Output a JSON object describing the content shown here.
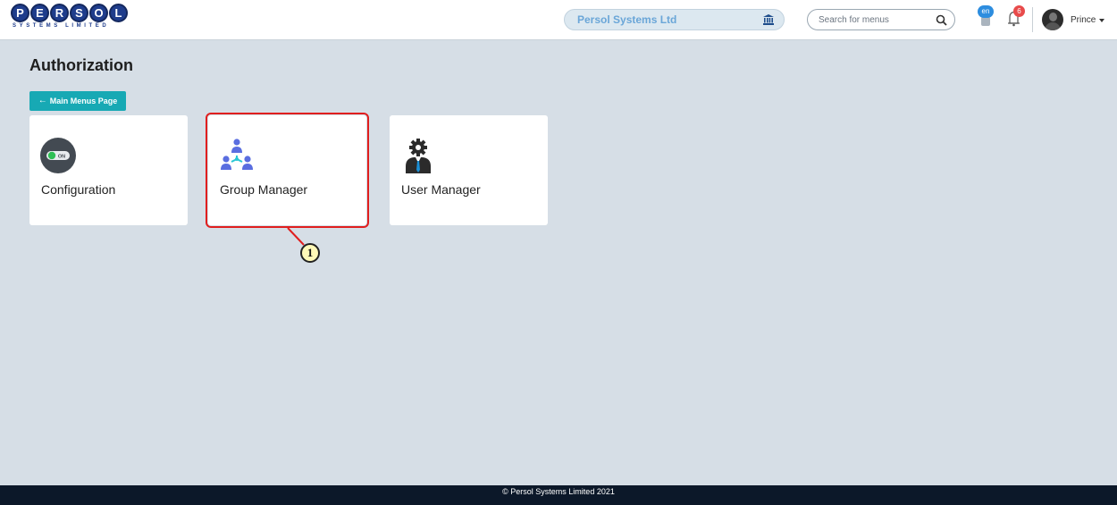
{
  "header": {
    "logo_letters": [
      "P",
      "E",
      "R",
      "S",
      "O",
      "L"
    ],
    "logo_subtitle": "SYSTEMS LIMITED",
    "company_name": "Persol Systems Ltd",
    "company_icon": "bank-icon",
    "search": {
      "placeholder": "Search for menus",
      "value": "",
      "icon": "search-icon"
    },
    "language_badge": "en",
    "notification_count": "6",
    "user_name": "Prince"
  },
  "page": {
    "title": "Authorization",
    "back_button_label": "Main Menus Page"
  },
  "cards": [
    {
      "label": "Configuration",
      "icon": "toggle-on-icon",
      "toggle_text": "ON"
    },
    {
      "label": "Group Manager",
      "icon": "group-network-icon"
    },
    {
      "label": "User Manager",
      "icon": "user-gear-icon"
    }
  ],
  "callout": {
    "number": "1"
  },
  "footer": {
    "text": "© Persol Systems Limited 2021"
  },
  "colors": {
    "accent_teal": "#17a9b4",
    "highlight_red": "#e01e1e",
    "footer_bg": "#0c1829",
    "page_bg": "#d6dee6"
  }
}
